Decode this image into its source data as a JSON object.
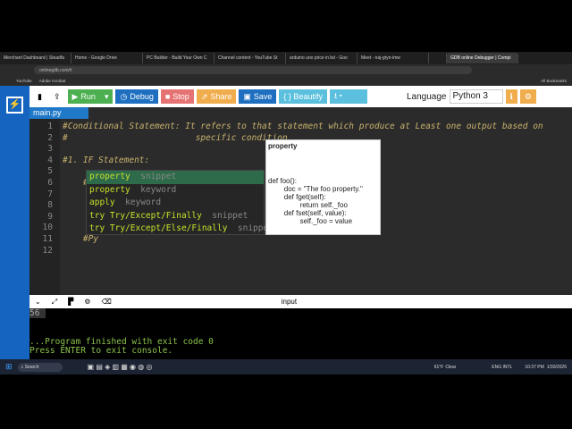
{
  "browser": {
    "tabs": [
      "Merchant Dashboard | Steadfa",
      "Home - Google Drive",
      "PC Builder - Build Your Own C",
      "Channel content - YouTube St",
      "arduino uno price in bd - Goo",
      "Meet - naj-gtyn-imw",
      "",
      "GDB online Debugger | Compi"
    ],
    "url": "onlinegdb.com/#",
    "bookmarks": [
      "YouTube",
      "Adobe Acrobat"
    ],
    "all_bookmarks": "All Bookmarks"
  },
  "toolbar": {
    "run": "Run",
    "debug": "Debug",
    "stop": "Stop",
    "share": "Share",
    "save": "Save",
    "beautify": "{ } Beautify",
    "language_label": "Language",
    "language": "Python 3"
  },
  "editor": {
    "file_tab": "main.py",
    "lines": [
      "#Conditional Statement: It refers to that statement which produce at Least one output based on",
      "#                         specific condition",
      "",
      "#1. IF Statement:",
      "",
      "    #",
      "    ",
      "    ",
      "    ",
      "    ",
      "    #Py",
      ""
    ],
    "autocomplete": [
      {
        "match": "property",
        "type": "snippet"
      },
      {
        "match": "property",
        "type": "keyword"
      },
      {
        "match": "apply",
        "type": "keyword"
      },
      {
        "match": "try Try/Except/Finally",
        "type": "snippet"
      },
      {
        "match": "try Try/Except/Else/Finally",
        "type": "snippet"
      }
    ],
    "doc": {
      "title": "property",
      "body": "def foo():\n        doc = \"The foo property.\"\n        def fget(self):\n                return self._foo\n        def fset(self, value):\n                self._foo = value"
    }
  },
  "console": {
    "header": "input",
    "lines": [
      "56",
      "",
      "",
      "...Program finished with exit code 0",
      "Press ENTER to exit console."
    ]
  },
  "taskbar": {
    "search": "Search",
    "weather": "61°F",
    "weather_desc": "Clear",
    "lang": "ENG INTL",
    "time": "10:37 PM",
    "date": "1/30/2026"
  }
}
